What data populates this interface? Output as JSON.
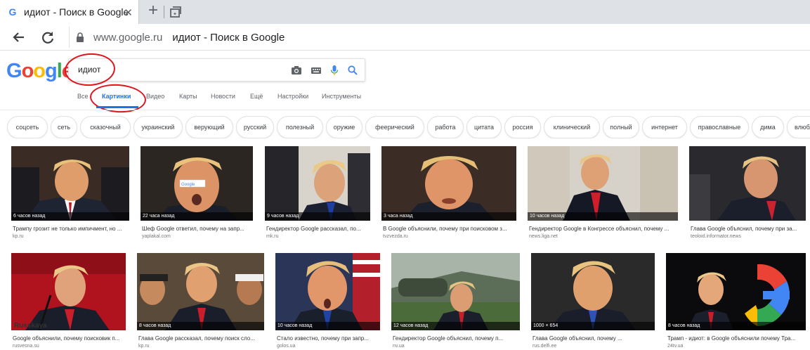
{
  "browser": {
    "tab_title": "идиот - Поиск в Google",
    "tab_favicon": "G",
    "tab_close": "✕",
    "new_tab": "+",
    "url_domain": "www.google.ru",
    "url_title": "идиот - Поиск в Google"
  },
  "logo": {
    "letters": [
      {
        "char": "G",
        "color": "#4285f4"
      },
      {
        "char": "o",
        "color": "#ea4335"
      },
      {
        "char": "o",
        "color": "#fbbc05"
      },
      {
        "char": "g",
        "color": "#4285f4"
      },
      {
        "char": "l",
        "color": "#34a853"
      },
      {
        "char": "e",
        "color": "#ea4335"
      }
    ]
  },
  "search": {
    "query": "идиот",
    "icons": [
      "camera-icon",
      "keyboard-icon",
      "mic-icon",
      "search-icon"
    ]
  },
  "annotation_color": "#e1141d",
  "tabs": [
    {
      "label": "Все",
      "active": false
    },
    {
      "label": "Картинки",
      "active": true
    },
    {
      "label": "Видео",
      "active": false
    },
    {
      "label": "Карты",
      "active": false
    },
    {
      "label": "Новости",
      "active": false
    },
    {
      "label": "Ещё",
      "active": false
    },
    {
      "label": "Настройки",
      "active": false
    },
    {
      "label": "Инструменты",
      "active": false
    }
  ],
  "chips": [
    "соцсеть",
    "сеть",
    "сказочный",
    "украинский",
    "верующий",
    "русский",
    "полезный",
    "оружие",
    "феерический",
    "работа",
    "цитата",
    "россия",
    "клинический",
    "полный",
    "интернет",
    "православные",
    "дима",
    "влюбл"
  ],
  "results_row1": [
    {
      "time": "6 часов назад",
      "title": "Трампу грозит не только импичмент, но ...",
      "source": "kp.ru"
    },
    {
      "time": "22 часа назад",
      "title": "Шеф Google ответил, почему на запр...",
      "source": "yaplakal.com"
    },
    {
      "time": "9 часов назад",
      "title": "Гендиректор Google рассказал, по...",
      "source": "mk.ru"
    },
    {
      "time": "3 часа назад",
      "title": "В Google объяснили, почему при поисковом з...",
      "source": "tvzvezda.ru"
    },
    {
      "time": "10 часов назад",
      "title": "Гендиректор Google в Конгрессе объяснил, почему ...",
      "source": "news.liga.net"
    },
    {
      "time": "",
      "title": "Глава Google объяснил, почему при за...",
      "source": "teoloid.informator.news"
    }
  ],
  "results_row2": [
    {
      "time": "",
      "title": "Google объяснили, почему поисковик п...",
      "source": "rusvesna.su"
    },
    {
      "time": "8 часов назад",
      "title": "Глава Google рассказал, почему поиск сло...",
      "source": "kp.ru"
    },
    {
      "time": "10 часов назад",
      "title": "Стало известно, почему при запр...",
      "source": "golos.ua"
    },
    {
      "time": "12 часов назад",
      "title": "Гендиректор Google объяснил, почему п...",
      "source": "nv.ua"
    },
    {
      "time": "1000 × 654",
      "title": "Глава Google объяснил, почему ...",
      "source": "rus.delfi.ee"
    },
    {
      "time": "8 часов назад",
      "title": "Трамп - идиот: в Google объяснили почему Тра...",
      "source": "24tv.ua"
    }
  ]
}
